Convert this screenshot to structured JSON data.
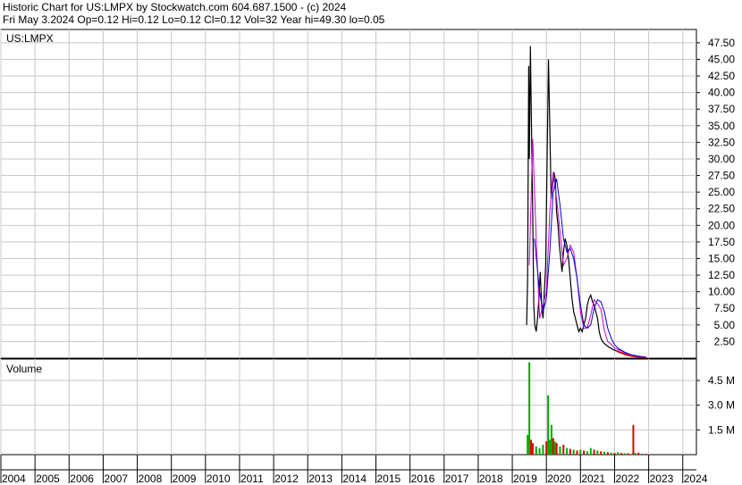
{
  "header": {
    "line1": "Historic Chart for US:LMPX by Stockwatch.com 604.687.1500 - (c) 2024",
    "line2": "Fri May  3.2024  Op=0.12  Hi=0.12  Lo=0.12  Cl=0.12  Vol=32  Year hi=49.30  lo=0.05"
  },
  "colors": {
    "price": "#000000",
    "ma_short": "#cc00cc",
    "ma_long": "#0000cc",
    "recent_price": "#cc0000",
    "volume_up": "#00aa00",
    "volume_down": "#dd0000",
    "grid": "#c8c8c8"
  },
  "chart_data": [
    {
      "type": "line",
      "label": "US:LMPX",
      "y_ticks": [
        "2.50",
        "5.00",
        "7.50",
        "10.00",
        "12.50",
        "15.00",
        "17.50",
        "20.00",
        "22.50",
        "25.00",
        "27.50",
        "30.00",
        "32.50",
        "35.00",
        "37.50",
        "40.00",
        "42.50",
        "45.00",
        "47.50"
      ],
      "ylim": [
        0,
        49.5
      ],
      "x_ticks": [
        "2004",
        "2005",
        "2006",
        "2007",
        "2008",
        "2009",
        "2010",
        "2011",
        "2012",
        "2013",
        "2014",
        "2015",
        "2016",
        "2017",
        "2018",
        "2019",
        "2020",
        "2021",
        "2022",
        "2023",
        "2024"
      ],
      "xlim": [
        2004.0,
        2024.4
      ],
      "grid": true,
      "series": [
        {
          "role": "price",
          "x": [
            2019.42,
            2019.45,
            2019.48,
            2019.5,
            2019.53,
            2019.56,
            2019.6,
            2019.63,
            2019.66,
            2019.7,
            2019.74,
            2019.78,
            2019.82,
            2019.86,
            2019.9,
            2019.94,
            2019.98,
            2020.02,
            2020.06,
            2020.1,
            2020.14,
            2020.18,
            2020.22,
            2020.26,
            2020.3,
            2020.34,
            2020.38,
            2020.42,
            2020.46,
            2020.5,
            2020.55,
            2020.6,
            2020.65,
            2020.7,
            2020.75,
            2020.8,
            2020.85,
            2020.9,
            2020.95,
            2021.0,
            2021.05,
            2021.1,
            2021.15,
            2021.2,
            2021.25,
            2021.3,
            2021.35,
            2021.4,
            2021.45,
            2021.5,
            2021.55,
            2021.6,
            2021.65,
            2021.7,
            2021.75,
            2021.8,
            2021.85,
            2021.9,
            2021.95,
            2022.0,
            2022.05,
            2022.1,
            2022.15,
            2022.2,
            2022.25,
            2022.3,
            2022.35,
            2022.4,
            2022.45,
            2022.5,
            2022.55,
            2022.6,
            2022.65,
            2022.7,
            2022.75,
            2022.8,
            2022.85,
            2022.9
          ],
          "y": [
            5,
            12,
            44,
            30,
            47,
            36,
            22,
            8,
            5,
            4,
            6,
            9,
            13,
            8,
            6,
            10,
            14,
            30,
            45,
            35,
            24,
            26,
            28,
            27,
            22,
            20,
            17,
            15,
            13,
            16,
            18,
            17,
            15,
            12,
            9,
            7,
            6,
            5,
            4,
            4.5,
            4,
            5,
            6,
            8,
            9,
            9.5,
            8.5,
            8,
            7,
            6,
            4,
            3,
            2.5,
            2.2,
            2,
            1.8,
            1.6,
            1.5,
            1.3,
            1.2,
            1.1,
            1.0,
            0.9,
            0.8,
            0.7,
            0.6,
            0.5,
            0.45,
            0.4,
            0.35,
            0.3,
            0.28,
            0.25,
            0.2,
            0.18,
            0.15,
            0.13,
            0.12
          ]
        },
        {
          "role": "moving-average-short",
          "x": [
            2019.5,
            2019.6,
            2019.7,
            2019.8,
            2019.9,
            2020.0,
            2020.1,
            2020.2,
            2020.3,
            2020.4,
            2020.5,
            2020.6,
            2020.7,
            2020.8,
            2020.9,
            2021.0,
            2021.1,
            2021.2,
            2021.3,
            2021.4,
            2021.5,
            2021.6,
            2021.7,
            2021.8,
            2021.9,
            2022.0,
            2022.1,
            2022.2,
            2022.3,
            2022.4,
            2022.5,
            2022.6,
            2022.7,
            2022.8,
            2022.9
          ],
          "y": [
            14,
            33,
            18,
            6,
            8,
            10,
            22,
            28,
            24,
            19,
            14,
            15,
            17,
            16,
            12,
            7,
            4.5,
            4.6,
            6.5,
            8.8,
            8.2,
            7.4,
            4.2,
            2.5,
            2.1,
            1.5,
            1.3,
            1.1,
            0.8,
            0.6,
            0.45,
            0.35,
            0.25,
            0.18,
            0.14
          ]
        },
        {
          "role": "moving-average-long",
          "x": [
            2019.65,
            2019.8,
            2019.9,
            2020.0,
            2020.1,
            2020.2,
            2020.3,
            2020.4,
            2020.5,
            2020.6,
            2020.7,
            2020.8,
            2020.9,
            2021.0,
            2021.1,
            2021.2,
            2021.3,
            2021.4,
            2021.5,
            2021.6,
            2021.7,
            2021.8,
            2021.9,
            2022.0,
            2022.1,
            2022.2,
            2022.3,
            2022.4,
            2022.5,
            2022.6,
            2022.7,
            2022.8,
            2022.9
          ],
          "y": [
            18,
            10,
            7,
            9,
            16,
            25,
            27,
            23,
            18,
            16,
            16.5,
            15,
            12,
            8,
            5,
            4.5,
            5,
            7.5,
            8.8,
            8.5,
            7,
            4.5,
            3,
            2,
            1.5,
            1.2,
            0.9,
            0.7,
            0.5,
            0.4,
            0.3,
            0.2,
            0.15
          ]
        }
      ]
    },
    {
      "type": "bar",
      "label": "Volume",
      "y_ticks": [
        "1.5 M",
        "3.0 M",
        "4.5 M"
      ],
      "ylim": [
        0,
        5.8
      ],
      "xlim": [
        2004.0,
        2024.4
      ],
      "bars": [
        {
          "x": 2019.45,
          "v": 1.2,
          "up": true
        },
        {
          "x": 2019.5,
          "v": 5.6,
          "up": true
        },
        {
          "x": 2019.55,
          "v": 0.9,
          "up": false
        },
        {
          "x": 2019.6,
          "v": 0.7,
          "up": false
        },
        {
          "x": 2019.7,
          "v": 0.5,
          "up": true
        },
        {
          "x": 2019.8,
          "v": 0.4,
          "up": true
        },
        {
          "x": 2019.9,
          "v": 0.6,
          "up": true
        },
        {
          "x": 2020.0,
          "v": 0.8,
          "up": false
        },
        {
          "x": 2020.05,
          "v": 3.6,
          "up": true
        },
        {
          "x": 2020.1,
          "v": 0.9,
          "up": true
        },
        {
          "x": 2020.15,
          "v": 1.8,
          "up": true
        },
        {
          "x": 2020.2,
          "v": 1.0,
          "up": false
        },
        {
          "x": 2020.25,
          "v": 0.8,
          "up": true
        },
        {
          "x": 2020.3,
          "v": 0.7,
          "up": false
        },
        {
          "x": 2020.4,
          "v": 0.5,
          "up": true
        },
        {
          "x": 2020.5,
          "v": 0.6,
          "up": false
        },
        {
          "x": 2020.6,
          "v": 0.4,
          "up": true
        },
        {
          "x": 2020.7,
          "v": 0.35,
          "up": false
        },
        {
          "x": 2020.8,
          "v": 0.3,
          "up": true
        },
        {
          "x": 2020.9,
          "v": 0.25,
          "up": false
        },
        {
          "x": 2021.0,
          "v": 0.3,
          "up": true
        },
        {
          "x": 2021.1,
          "v": 0.25,
          "up": false
        },
        {
          "x": 2021.2,
          "v": 0.2,
          "up": true
        },
        {
          "x": 2021.3,
          "v": 0.4,
          "up": true
        },
        {
          "x": 2021.4,
          "v": 0.3,
          "up": false
        },
        {
          "x": 2021.5,
          "v": 0.25,
          "up": true
        },
        {
          "x": 2021.6,
          "v": 0.2,
          "up": false
        },
        {
          "x": 2021.7,
          "v": 0.18,
          "up": true
        },
        {
          "x": 2021.8,
          "v": 0.15,
          "up": false
        },
        {
          "x": 2021.9,
          "v": 0.12,
          "up": true
        },
        {
          "x": 2022.0,
          "v": 0.1,
          "up": false
        },
        {
          "x": 2022.1,
          "v": 0.15,
          "up": true
        },
        {
          "x": 2022.2,
          "v": 0.1,
          "up": false
        },
        {
          "x": 2022.3,
          "v": 0.08,
          "up": true
        },
        {
          "x": 2022.4,
          "v": 0.08,
          "up": false
        },
        {
          "x": 2022.55,
          "v": 1.8,
          "up": false
        },
        {
          "x": 2022.6,
          "v": 0.1,
          "up": true
        },
        {
          "x": 2022.7,
          "v": 0.12,
          "up": false
        },
        {
          "x": 2022.8,
          "v": 0.06,
          "up": true
        },
        {
          "x": 2022.9,
          "v": 0.05,
          "up": false
        }
      ]
    }
  ]
}
